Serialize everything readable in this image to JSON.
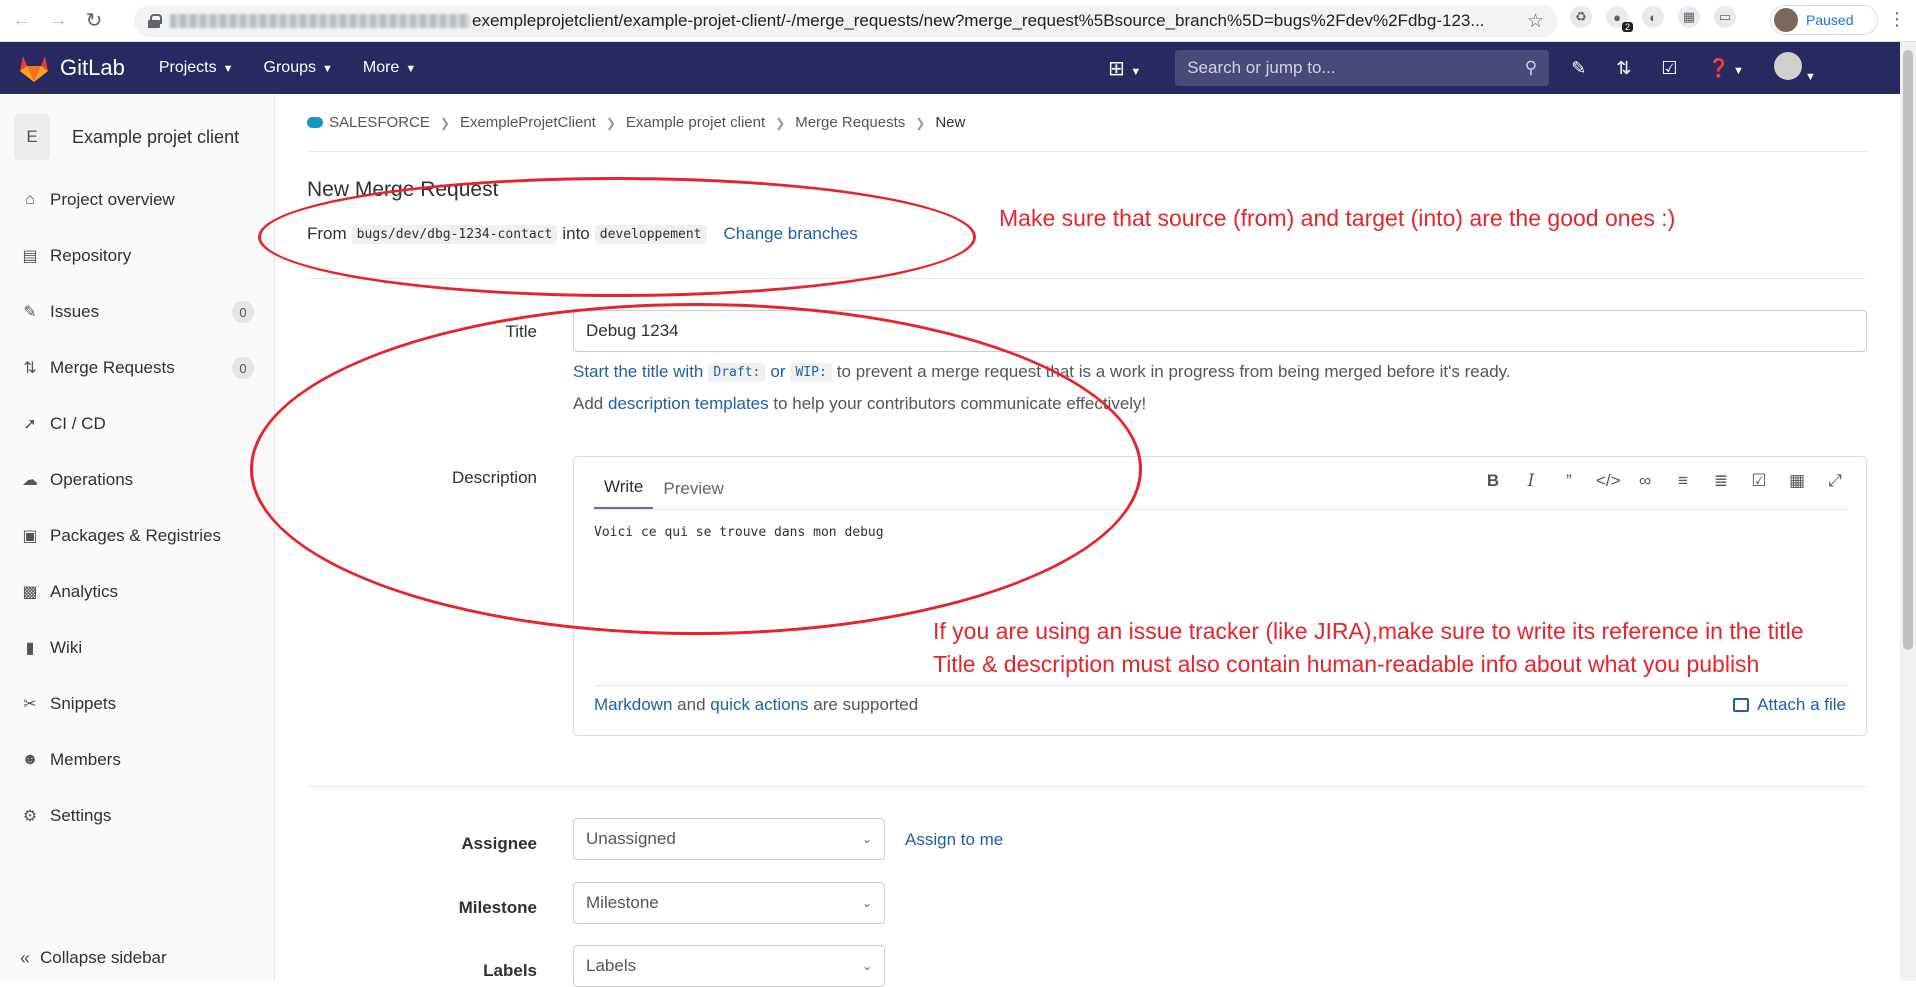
{
  "browser": {
    "url_suffix": "exempleprojetclient/example-projet-client/-/merge_requests/new?merge_request%5Bsource_branch%5D=bugs%2Fdev%2Fdbg-123...",
    "profile_status": "Paused",
    "ext_badge": "2"
  },
  "navbar": {
    "brand": "GitLab",
    "menus": [
      "Projects",
      "Groups",
      "More"
    ],
    "search_placeholder": "Search or jump to..."
  },
  "sidebar": {
    "project_initial": "E",
    "project_name": "Example projet client",
    "items": [
      {
        "label": "Project overview",
        "icon": "home-icon"
      },
      {
        "label": "Repository",
        "icon": "doc-icon"
      },
      {
        "label": "Issues",
        "icon": "issues-icon",
        "count": "0"
      },
      {
        "label": "Merge Requests",
        "icon": "merge-request-icon",
        "count": "0"
      },
      {
        "label": "CI / CD",
        "icon": "rocket-icon"
      },
      {
        "label": "Operations",
        "icon": "cloud-icon"
      },
      {
        "label": "Packages & Registries",
        "icon": "package-icon"
      },
      {
        "label": "Analytics",
        "icon": "chart-icon"
      },
      {
        "label": "Wiki",
        "icon": "book-icon"
      },
      {
        "label": "Snippets",
        "icon": "scissors-icon"
      },
      {
        "label": "Members",
        "icon": "users-icon"
      },
      {
        "label": "Settings",
        "icon": "gear-icon"
      }
    ],
    "collapse_label": "Collapse sidebar"
  },
  "breadcrumb": [
    "SALESFORCE",
    "ExempleProjetClient",
    "Example projet client",
    "Merge Requests",
    "New"
  ],
  "page": {
    "title": "New Merge Request",
    "from_label": "From",
    "source_branch": "bugs/dev/dbg-1234-contact",
    "into_label": "into",
    "target_branch": "developpement",
    "change_branches": "Change branches"
  },
  "form": {
    "title_label": "Title",
    "title_value": "Debug 1234",
    "help_start": "Start the title with",
    "help_draft": "Draft:",
    "help_or": "or",
    "help_wip": "WIP:",
    "help_rest": "to prevent a merge request that is a work in progress from being merged before it's ready.",
    "help2_add": "Add",
    "help2_link": "description templates",
    "help2_rest": "to help your contributors communicate effectively!",
    "description_label": "Description",
    "tab_write": "Write",
    "tab_preview": "Preview",
    "description_value": "Voici ce qui se trouve dans mon debug",
    "footer_markdown": "Markdown",
    "footer_and": "and",
    "footer_quick": "quick actions",
    "footer_supported": "are supported",
    "attach_file": "Attach a file",
    "assignee_label": "Assignee",
    "assignee_value": "Unassigned",
    "assign_to_me": "Assign to me",
    "milestone_label": "Milestone",
    "milestone_value": "Milestone",
    "labels_label": "Labels",
    "labels_value": "Labels"
  },
  "annotations": {
    "branches_note": "Make sure that source (from) and target (into) are the good ones :)",
    "tracker_note_1": "If you are using an issue tracker (like JIRA),make sure to write its reference in the title",
    "tracker_note_2": "Title & description must also contain human-readable info about what you publish",
    "color": "#e5242c"
  }
}
